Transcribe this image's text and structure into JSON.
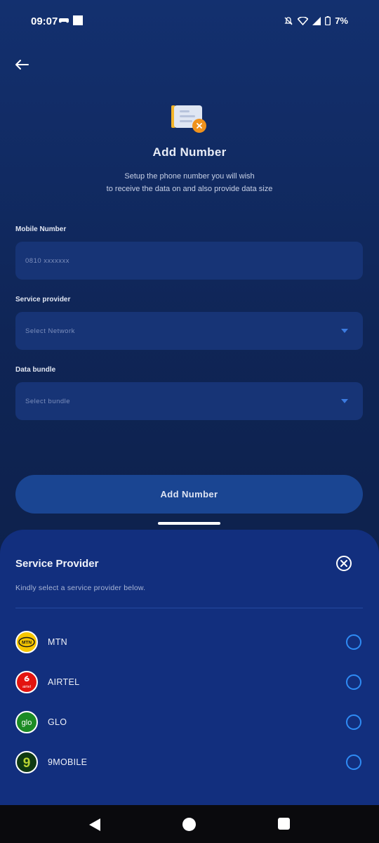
{
  "status_bar": {
    "time": "09:07",
    "battery": "7%",
    "icons": [
      "game-controller-icon",
      "notification-square-icon",
      "mute-icon",
      "wifi-icon",
      "signal-icon",
      "battery-icon"
    ]
  },
  "header": {
    "back_icon": "arrow-left-icon",
    "title": "Add Number",
    "subtitle_line1": "Setup the phone number you will wish",
    "subtitle_line2": "to receive the data on and also provide data size"
  },
  "form": {
    "mobile_label": "Mobile Number",
    "mobile_placeholder": "0810 xxxxxxx",
    "provider_label": "Service provider",
    "provider_placeholder": "Select Network",
    "bundle_label": "Data bundle",
    "bundle_placeholder": "Select bundle",
    "submit_label": "Add Number"
  },
  "sheet": {
    "title": "Service Provider",
    "description": "Kindly select a service provider below.",
    "providers": [
      {
        "name": "MTN",
        "logo_text": "MTN"
      },
      {
        "name": "AIRTEL",
        "logo_text": "airtel"
      },
      {
        "name": "GLO",
        "logo_text": "glo"
      },
      {
        "name": "9MOBILE",
        "logo_text": "9"
      }
    ]
  },
  "colors": {
    "background": "#0f2556",
    "field": "#173476",
    "sheet": "#122f7e",
    "button": "#1a4592",
    "radio": "#2f8cf5"
  }
}
